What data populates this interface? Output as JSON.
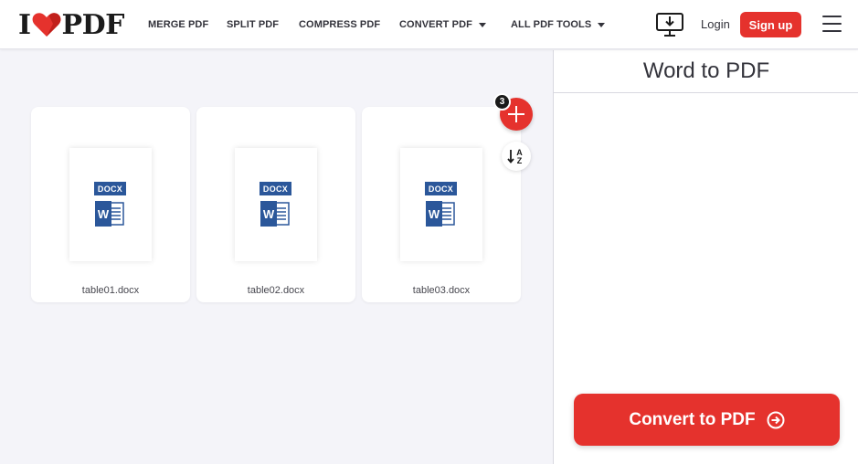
{
  "brand": {
    "logo_left": "I",
    "logo_right": "PDF",
    "accent": "#e5322d"
  },
  "nav": {
    "merge": "MERGE PDF",
    "split": "SPLIT PDF",
    "compress": "COMPRESS PDF",
    "convert": "CONVERT PDF",
    "all_tools": "ALL PDF TOOLS"
  },
  "header": {
    "login": "Login",
    "signup": "Sign up"
  },
  "files": {
    "count": "3",
    "items": [
      {
        "name": "table01.docx",
        "type": "DOCX"
      },
      {
        "name": "table02.docx",
        "type": "DOCX"
      },
      {
        "name": "table03.docx",
        "type": "DOCX"
      }
    ]
  },
  "panel": {
    "title": "Word to PDF",
    "convert_label": "Convert to PDF"
  },
  "icons": [
    "heart-logo-icon",
    "caret-down-icon",
    "desktop-download-icon",
    "hamburger-menu-icon",
    "plus-icon",
    "sort-az-icon",
    "word-icon",
    "arrow-right-circle-icon"
  ]
}
